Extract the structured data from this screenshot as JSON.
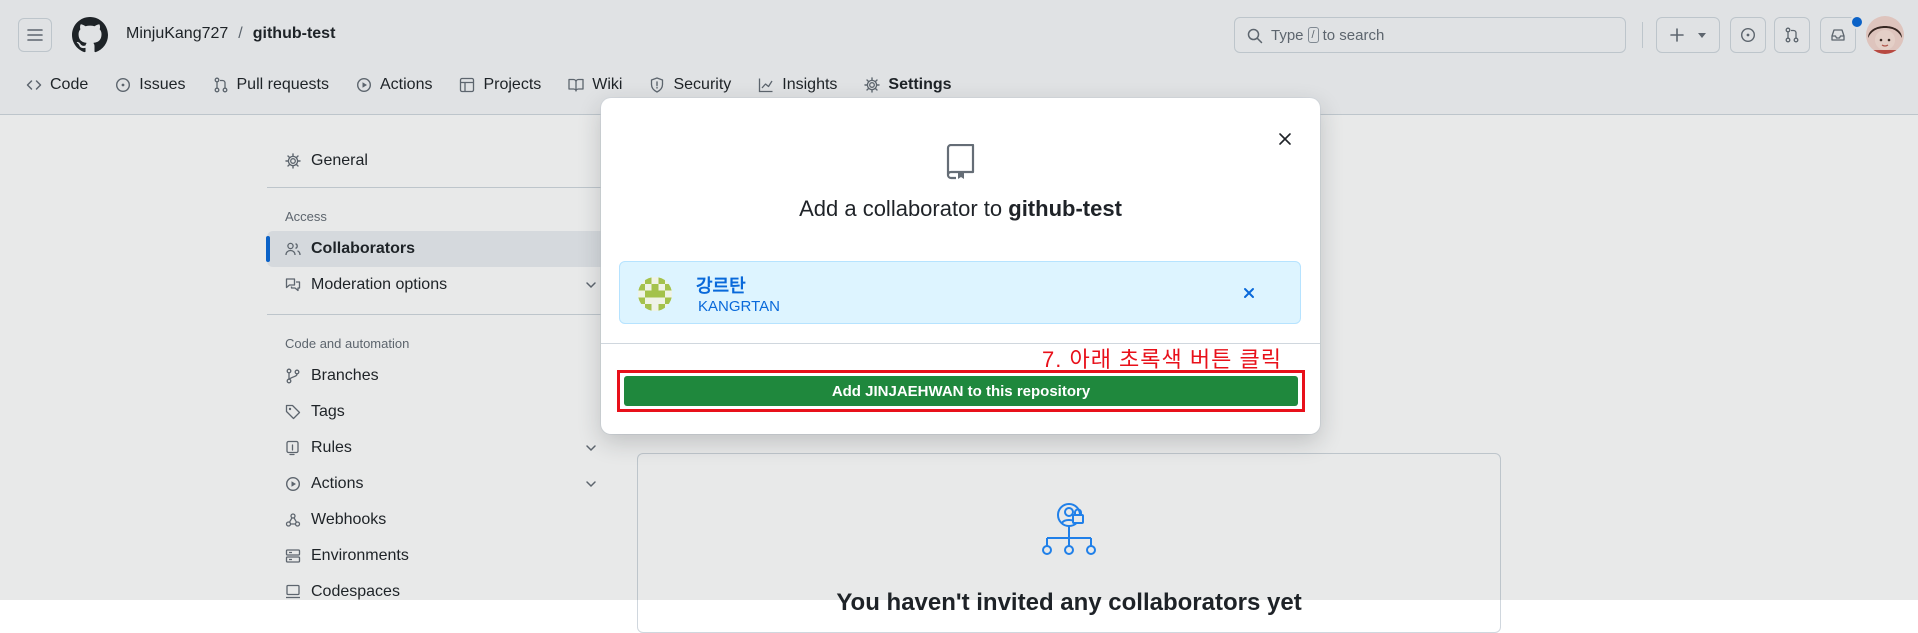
{
  "header": {
    "owner": "MinjuKang727",
    "separator": "/",
    "repo": "github-test",
    "search": {
      "prefix": "Type",
      "key": "/",
      "suffix": "to search"
    }
  },
  "repo_nav": {
    "tabs": [
      {
        "label": "Code",
        "icon": "code-icon"
      },
      {
        "label": "Issues",
        "icon": "issue-opened-icon"
      },
      {
        "label": "Pull requests",
        "icon": "git-pull-request-icon"
      },
      {
        "label": "Actions",
        "icon": "play-icon"
      },
      {
        "label": "Projects",
        "icon": "table-icon"
      },
      {
        "label": "Wiki",
        "icon": "book-icon"
      },
      {
        "label": "Security",
        "icon": "shield-icon"
      },
      {
        "label": "Insights",
        "icon": "graph-icon"
      },
      {
        "label": "Settings",
        "icon": "gear-icon",
        "active": true
      }
    ]
  },
  "sidebar": {
    "general": "General",
    "access_heading": "Access",
    "collaborators": "Collaborators",
    "moderation": "Moderation options",
    "code_heading": "Code and automation",
    "branches": "Branches",
    "tags": "Tags",
    "rules": "Rules",
    "actions": "Actions",
    "webhooks": "Webhooks",
    "environments": "Environments",
    "codespaces": "Codespaces"
  },
  "main": {
    "empty_title": "You haven't invited any collaborators yet"
  },
  "dialog": {
    "title_prefix": "Add a collaborator to",
    "title_repo": "github-test",
    "selected_user": {
      "name": "강르탄",
      "login": "KANGRTAN"
    },
    "add_button": "Add JINJAEHWAN to this repository",
    "annotation": "7. 아래 초록색 버튼 클릭"
  },
  "colors": {
    "accent": "#0969da",
    "primary_button": "#1f883d",
    "annotation": "#e8101a",
    "selected_user_bg": "#ddf4ff"
  }
}
